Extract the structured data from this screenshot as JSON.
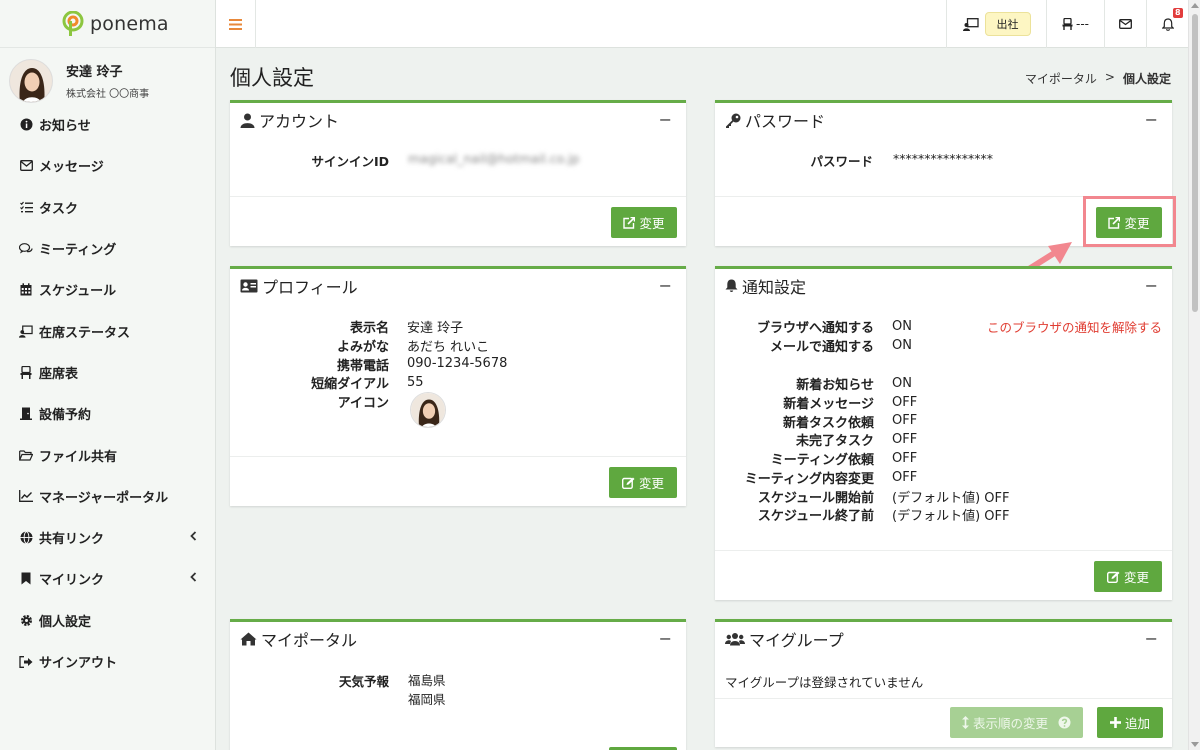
{
  "app": {
    "logo_text": "ponema"
  },
  "user": {
    "name": "安達 玲子",
    "company": "株式会社 〇〇商事"
  },
  "sidebar": {
    "items": [
      {
        "label": "お知らせ",
        "icon": "info-icon"
      },
      {
        "label": "メッセージ",
        "icon": "envelope-icon"
      },
      {
        "label": "タスク",
        "icon": "tasklist-icon"
      },
      {
        "label": "ミーティング",
        "icon": "comments-icon"
      },
      {
        "label": "スケジュール",
        "icon": "calendar-icon"
      },
      {
        "label": "在席ステータス",
        "icon": "presence-icon"
      },
      {
        "label": "座席表",
        "icon": "chair-icon"
      },
      {
        "label": "設備予約",
        "icon": "door-icon"
      },
      {
        "label": "ファイル共有",
        "icon": "folder-icon"
      },
      {
        "label": "マネージャーポータル",
        "icon": "chart-line-icon"
      },
      {
        "label": "共有リンク",
        "icon": "globe-icon"
      },
      {
        "label": "マイリンク",
        "icon": "bookmark-icon"
      },
      {
        "label": "個人設定",
        "icon": "gear-icon"
      },
      {
        "label": "サインアウト",
        "icon": "signout-icon"
      }
    ]
  },
  "topbar": {
    "status_label": "出社",
    "seat_label": "---",
    "notification_count": "8"
  },
  "page": {
    "title": "個人設定",
    "breadcrumb": {
      "parent": "マイポータル",
      "separator": ">",
      "current": "個人設定"
    }
  },
  "account": {
    "title": "アカウント",
    "signin_label": "サインインID",
    "signin_value": "magical_nail@hotmail.co.jp",
    "change_label": "変更"
  },
  "password": {
    "title": "パスワード",
    "label": "パスワード",
    "value": "****************",
    "change_label": "変更"
  },
  "profile": {
    "title": "プロフィール",
    "fields": [
      {
        "label": "表示名",
        "value": "安達 玲子"
      },
      {
        "label": "よみがな",
        "value": "あだち れいこ"
      },
      {
        "label": "携帯電話",
        "value": "090-1234-5678"
      },
      {
        "label": "短縮ダイアル",
        "value": "55"
      },
      {
        "label": "アイコン",
        "value": ""
      }
    ],
    "change_label": "変更"
  },
  "notification": {
    "title": "通知設定",
    "revoke_link": "このブラウザの通知を解除する",
    "group1": [
      {
        "label": "ブラウザへ通知する",
        "value": "ON"
      },
      {
        "label": "メールで通知する",
        "value": "ON"
      }
    ],
    "group2": [
      {
        "label": "新着お知らせ",
        "value": "ON"
      },
      {
        "label": "新着メッセージ",
        "value": "OFF"
      },
      {
        "label": "新着タスク依頼",
        "value": "OFF"
      },
      {
        "label": "未完了タスク",
        "value": "OFF"
      },
      {
        "label": "ミーティング依頼",
        "value": "OFF"
      },
      {
        "label": "ミーティング内容変更",
        "value": "OFF"
      },
      {
        "label": "スケジュール開始前",
        "value": "(デフォルト値) OFF"
      },
      {
        "label": "スケジュール終了前",
        "value": "(デフォルト値) OFF"
      }
    ],
    "change_label": "変更"
  },
  "myportal": {
    "title": "マイポータル",
    "weather_label": "天気予報",
    "weather_values": [
      "福島県",
      "福岡県"
    ]
  },
  "mygroup": {
    "title": "マイグループ",
    "empty_text": "マイグループは登録されていません",
    "reorder_label": "表示順の変更",
    "add_label": "追加"
  },
  "colors": {
    "accent": "#5fa83f",
    "card_border": "#66ac48",
    "highlight": "#f2878f",
    "link_red": "#e03c31",
    "badge": "#fdf6c3"
  }
}
